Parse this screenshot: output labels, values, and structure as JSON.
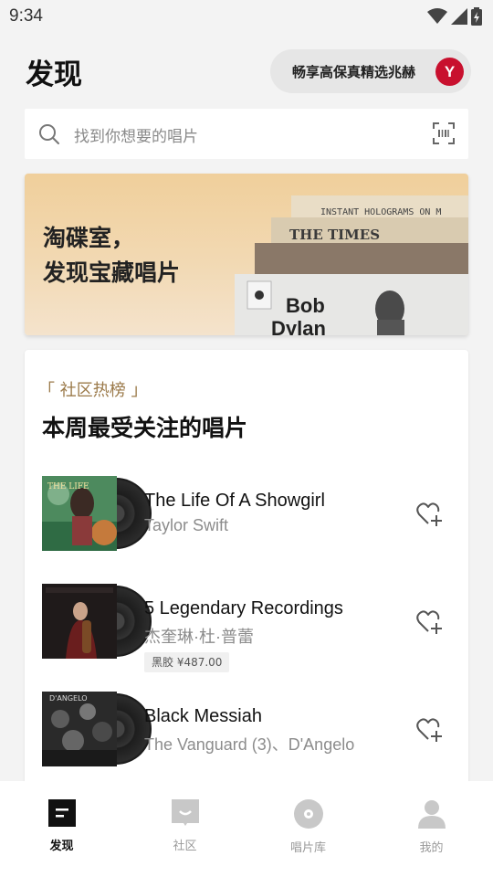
{
  "status_bar": {
    "time": "9:34"
  },
  "header": {
    "title": "发现",
    "promo_text": "畅享高保真精选兆赫",
    "promo_logo": "Y"
  },
  "search": {
    "placeholder": "找到你想要的唱片"
  },
  "banner": {
    "line1": "淘碟室，",
    "line2": "发现宝藏唱片",
    "art_text1": "INSTANT HOLOGRAMS ON M",
    "art_text2": "THE TIMES",
    "art_text3": "Bob",
    "art_text4": "Dylan"
  },
  "charts": {
    "tag": "「 社区热榜 」",
    "title": "本周最受关注的唱片",
    "records": [
      {
        "title": "The Life Of A Showgirl",
        "artist": "Taylor Swift",
        "price": ""
      },
      {
        "title": "5 Legendary Recordings",
        "artist": "杰奎琳·杜·普蕾",
        "price": "黑胶 ¥487.00"
      },
      {
        "title": "Black Messiah",
        "artist": "The Vanguard (3)、D'Angelo",
        "price": ""
      }
    ]
  },
  "tabbar": {
    "tabs": [
      {
        "label": "发现",
        "icon": "discover-icon",
        "active": true
      },
      {
        "label": "社区",
        "icon": "community-icon",
        "active": false
      },
      {
        "label": "唱片库",
        "icon": "record-library-icon",
        "active": false
      },
      {
        "label": "我的",
        "icon": "profile-icon",
        "active": false
      }
    ]
  },
  "colors": {
    "accent": "#9b7a4a",
    "brand_red": "#c8102e"
  }
}
